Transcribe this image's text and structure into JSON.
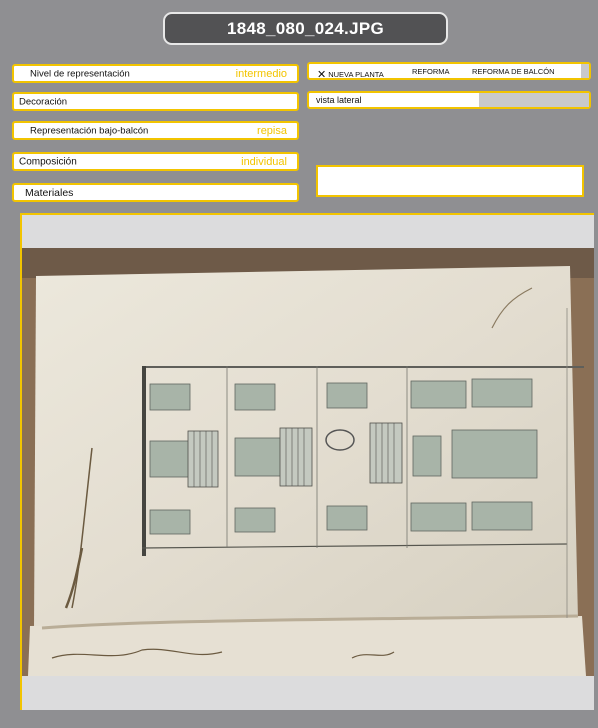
{
  "title": "1848_080_024.JPG",
  "fields": {
    "nivel": {
      "label": "Nivel de representación",
      "value": "intermedio"
    },
    "decoracion": {
      "label": "Decoración"
    },
    "representacion": {
      "label": "Representación bajo-balcón",
      "value": "repisa"
    },
    "composicion": {
      "label": "Composición",
      "value": "individual"
    },
    "materiales": {
      "label": "Materiales"
    }
  },
  "obra": {
    "mark": "✕",
    "options": [
      "NUEVA PLANTA",
      "REFORMA",
      "REFORMA DE BALCÓN"
    ]
  },
  "vista": {
    "label": "vista lateral"
  },
  "notes": {
    "value": ""
  },
  "colors": {
    "accent": "#f2c400",
    "background": "#8f8f92",
    "title_bg": "#525254"
  }
}
